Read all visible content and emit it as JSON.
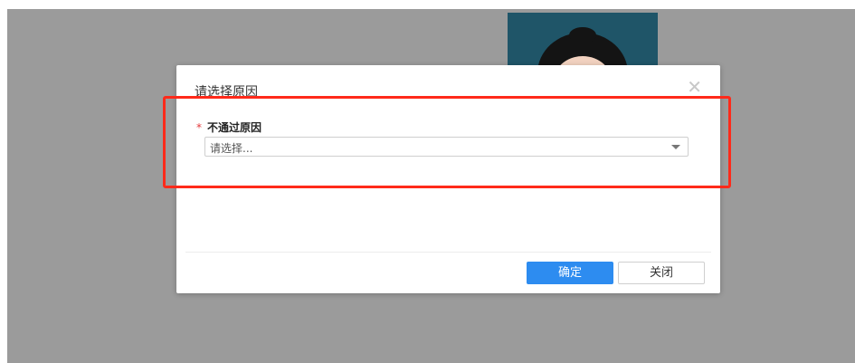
{
  "dialog": {
    "title": "请选择原因",
    "close_icon": "close-icon",
    "field": {
      "required_mark": "*",
      "label": "不通过原因",
      "select_placeholder": "请选择..."
    },
    "buttons": {
      "confirm_label": "确定",
      "close_label": "关闭"
    }
  },
  "colors": {
    "overlay": "#9b9b9b",
    "primary_button": "#2d8cf0",
    "highlight_box": "#ff2a1a",
    "required_mark": "#e4393c"
  },
  "background_photo": "portrait-photo"
}
